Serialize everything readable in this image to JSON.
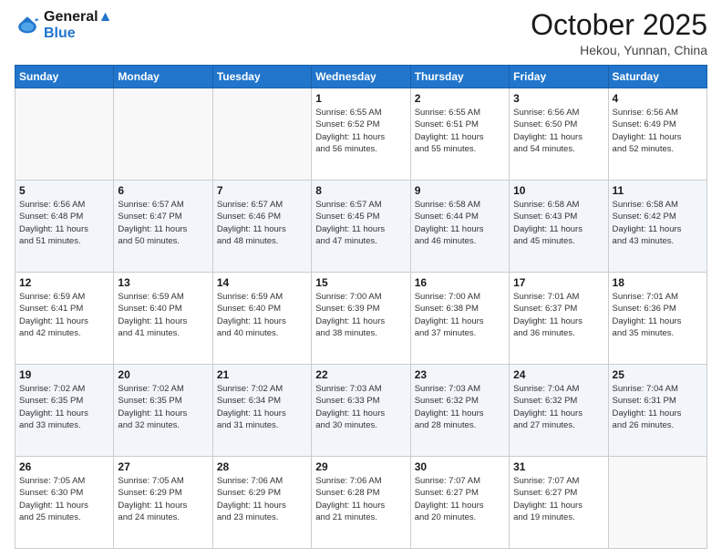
{
  "header": {
    "logo_line1": "General",
    "logo_line2": "Blue",
    "month": "October 2025",
    "location": "Hekou, Yunnan, China"
  },
  "weekdays": [
    "Sunday",
    "Monday",
    "Tuesday",
    "Wednesday",
    "Thursday",
    "Friday",
    "Saturday"
  ],
  "weeks": [
    [
      {
        "day": "",
        "info": ""
      },
      {
        "day": "",
        "info": ""
      },
      {
        "day": "",
        "info": ""
      },
      {
        "day": "1",
        "info": "Sunrise: 6:55 AM\nSunset: 6:52 PM\nDaylight: 11 hours\nand 56 minutes."
      },
      {
        "day": "2",
        "info": "Sunrise: 6:55 AM\nSunset: 6:51 PM\nDaylight: 11 hours\nand 55 minutes."
      },
      {
        "day": "3",
        "info": "Sunrise: 6:56 AM\nSunset: 6:50 PM\nDaylight: 11 hours\nand 54 minutes."
      },
      {
        "day": "4",
        "info": "Sunrise: 6:56 AM\nSunset: 6:49 PM\nDaylight: 11 hours\nand 52 minutes."
      }
    ],
    [
      {
        "day": "5",
        "info": "Sunrise: 6:56 AM\nSunset: 6:48 PM\nDaylight: 11 hours\nand 51 minutes."
      },
      {
        "day": "6",
        "info": "Sunrise: 6:57 AM\nSunset: 6:47 PM\nDaylight: 11 hours\nand 50 minutes."
      },
      {
        "day": "7",
        "info": "Sunrise: 6:57 AM\nSunset: 6:46 PM\nDaylight: 11 hours\nand 48 minutes."
      },
      {
        "day": "8",
        "info": "Sunrise: 6:57 AM\nSunset: 6:45 PM\nDaylight: 11 hours\nand 47 minutes."
      },
      {
        "day": "9",
        "info": "Sunrise: 6:58 AM\nSunset: 6:44 PM\nDaylight: 11 hours\nand 46 minutes."
      },
      {
        "day": "10",
        "info": "Sunrise: 6:58 AM\nSunset: 6:43 PM\nDaylight: 11 hours\nand 45 minutes."
      },
      {
        "day": "11",
        "info": "Sunrise: 6:58 AM\nSunset: 6:42 PM\nDaylight: 11 hours\nand 43 minutes."
      }
    ],
    [
      {
        "day": "12",
        "info": "Sunrise: 6:59 AM\nSunset: 6:41 PM\nDaylight: 11 hours\nand 42 minutes."
      },
      {
        "day": "13",
        "info": "Sunrise: 6:59 AM\nSunset: 6:40 PM\nDaylight: 11 hours\nand 41 minutes."
      },
      {
        "day": "14",
        "info": "Sunrise: 6:59 AM\nSunset: 6:40 PM\nDaylight: 11 hours\nand 40 minutes."
      },
      {
        "day": "15",
        "info": "Sunrise: 7:00 AM\nSunset: 6:39 PM\nDaylight: 11 hours\nand 38 minutes."
      },
      {
        "day": "16",
        "info": "Sunrise: 7:00 AM\nSunset: 6:38 PM\nDaylight: 11 hours\nand 37 minutes."
      },
      {
        "day": "17",
        "info": "Sunrise: 7:01 AM\nSunset: 6:37 PM\nDaylight: 11 hours\nand 36 minutes."
      },
      {
        "day": "18",
        "info": "Sunrise: 7:01 AM\nSunset: 6:36 PM\nDaylight: 11 hours\nand 35 minutes."
      }
    ],
    [
      {
        "day": "19",
        "info": "Sunrise: 7:02 AM\nSunset: 6:35 PM\nDaylight: 11 hours\nand 33 minutes."
      },
      {
        "day": "20",
        "info": "Sunrise: 7:02 AM\nSunset: 6:35 PM\nDaylight: 11 hours\nand 32 minutes."
      },
      {
        "day": "21",
        "info": "Sunrise: 7:02 AM\nSunset: 6:34 PM\nDaylight: 11 hours\nand 31 minutes."
      },
      {
        "day": "22",
        "info": "Sunrise: 7:03 AM\nSunset: 6:33 PM\nDaylight: 11 hours\nand 30 minutes."
      },
      {
        "day": "23",
        "info": "Sunrise: 7:03 AM\nSunset: 6:32 PM\nDaylight: 11 hours\nand 28 minutes."
      },
      {
        "day": "24",
        "info": "Sunrise: 7:04 AM\nSunset: 6:32 PM\nDaylight: 11 hours\nand 27 minutes."
      },
      {
        "day": "25",
        "info": "Sunrise: 7:04 AM\nSunset: 6:31 PM\nDaylight: 11 hours\nand 26 minutes."
      }
    ],
    [
      {
        "day": "26",
        "info": "Sunrise: 7:05 AM\nSunset: 6:30 PM\nDaylight: 11 hours\nand 25 minutes."
      },
      {
        "day": "27",
        "info": "Sunrise: 7:05 AM\nSunset: 6:29 PM\nDaylight: 11 hours\nand 24 minutes."
      },
      {
        "day": "28",
        "info": "Sunrise: 7:06 AM\nSunset: 6:29 PM\nDaylight: 11 hours\nand 23 minutes."
      },
      {
        "day": "29",
        "info": "Sunrise: 7:06 AM\nSunset: 6:28 PM\nDaylight: 11 hours\nand 21 minutes."
      },
      {
        "day": "30",
        "info": "Sunrise: 7:07 AM\nSunset: 6:27 PM\nDaylight: 11 hours\nand 20 minutes."
      },
      {
        "day": "31",
        "info": "Sunrise: 7:07 AM\nSunset: 6:27 PM\nDaylight: 11 hours\nand 19 minutes."
      },
      {
        "day": "",
        "info": ""
      }
    ]
  ]
}
